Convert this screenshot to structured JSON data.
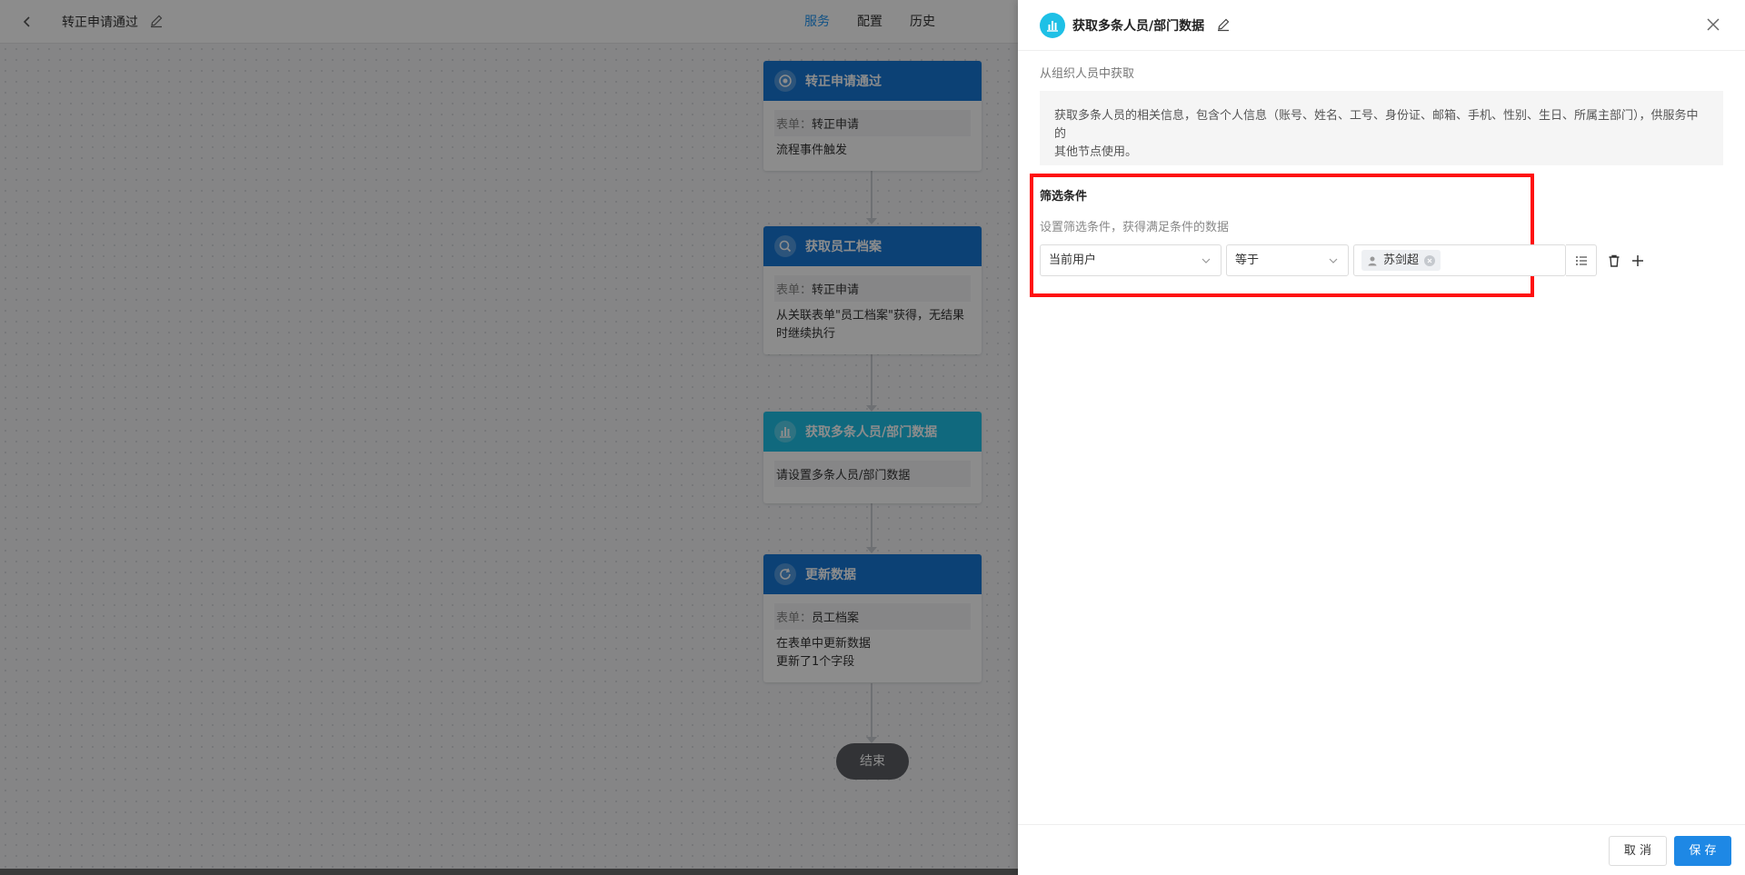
{
  "topbar": {
    "title": "转正申请通过",
    "tabs": [
      {
        "label": "服务",
        "active": true
      },
      {
        "label": "配置",
        "active": false
      },
      {
        "label": "历史",
        "active": false
      }
    ]
  },
  "flow": {
    "nodes": [
      {
        "title": "转正申请通过",
        "icon": "target-icon",
        "color": "#1677d6",
        "chip_key": "表单：",
        "chip_value": "转正申请",
        "lines": [
          "流程事件触发"
        ]
      },
      {
        "title": "获取员工档案",
        "icon": "search-icon",
        "color": "#1677d6",
        "chip_key": "表单：",
        "chip_value": "转正申请",
        "lines": [
          "从关联表单\"员工档案\"获得，无结果",
          "时继续执行"
        ]
      },
      {
        "title": "获取多条人员/部门数据",
        "icon": "bar-chart-icon",
        "color": "#1ec0e6",
        "lines": [
          "请设置多条人员/部门数据"
        ]
      },
      {
        "title": "更新数据",
        "icon": "refresh-icon",
        "color": "#1677d6",
        "chip_key": "表单：",
        "chip_value": "员工档案",
        "lines": [
          "在表单中更新数据",
          "更新了1个字段"
        ]
      }
    ],
    "end_label": "结束"
  },
  "panel": {
    "title": "获取多条人员/部门数据",
    "subtitle": "从组织人员中获取",
    "description_line1": "获取多条人员的相关信息，包含个人信息（账号、姓名、工号、身份证、邮箱、手机、性别、生日、所属主部门），供服务中的",
    "description_line2": "其他节点使用。",
    "filter": {
      "title": "筛选条件",
      "hint": "设置筛选条件，获得满足条件的数据",
      "field": "当前用户",
      "operator": "等于",
      "value_tag": "苏剑超"
    },
    "footer": {
      "cancel_label": "取 消",
      "save_label": "保 存"
    }
  },
  "colors": {
    "accent": "#1e88e5",
    "node_blue": "#1677d6",
    "node_cyan": "#1ec0e6",
    "highlight": "#ff1010"
  }
}
